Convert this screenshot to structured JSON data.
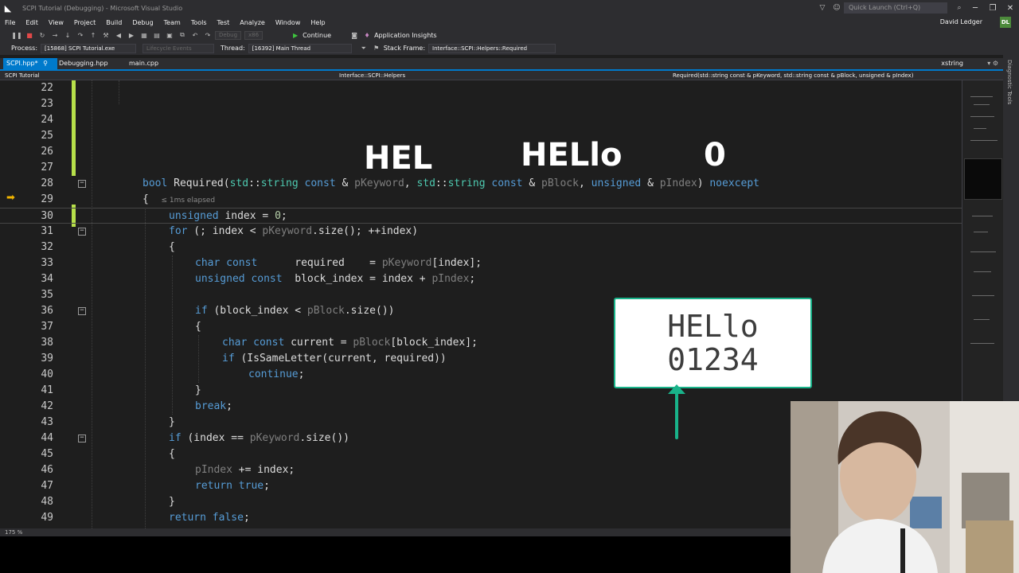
{
  "title_bar": {
    "title": "SCPI Tutorial (Debugging) - Microsoft Visual Studio",
    "quick_launch": "Quick Launch (Ctrl+Q)"
  },
  "menu": [
    "File",
    "Edit",
    "View",
    "Project",
    "Build",
    "Debug",
    "Team",
    "Tools",
    "Test",
    "Analyze",
    "Window",
    "Help"
  ],
  "user": {
    "name": "David Ledger",
    "initials": "DL"
  },
  "toolbar": {
    "config": "Debug",
    "platform": "x86",
    "continue_label": "Continue",
    "insights_label": "Application Insights"
  },
  "debug_location": {
    "process_label": "Process:",
    "process": "[15868] SCPI Tutorial.exe",
    "lifecycle": "Lifecycle Events",
    "thread_label": "Thread:",
    "thread": "[16392] Main Thread",
    "stack_label": "Stack Frame:",
    "stack": "Interface::SCPI::Helpers::Required"
  },
  "tabs": [
    {
      "label": "SCPI.hpp*",
      "active": true
    },
    {
      "label": "Debugging.hpp",
      "active": false
    },
    {
      "label": "main.cpp",
      "active": false
    }
  ],
  "tab_right": "xstring",
  "nav_bar": {
    "project": "SCPI Tutorial",
    "scope": "Interface::SCPI::Helpers",
    "member": "Required(std::string const & pKeyword, std::string const & pBlock, unsigned & pIndex)"
  },
  "side_panel_label": "Diagnostic Tools",
  "elapsed": "≤ 1ms elapsed",
  "line_numbers": [
    "22",
    "23",
    "24",
    "25",
    "26",
    "27",
    "28",
    "29",
    "30",
    "31",
    "32",
    "33",
    "34",
    "35",
    "36",
    "37",
    "38",
    "39",
    "40",
    "41",
    "42",
    "43",
    "44",
    "45",
    "46",
    "47",
    "48",
    "49"
  ],
  "overlay": {
    "text1": "HEL",
    "text2": "HELlo",
    "text3": "0",
    "card_line1": "HELlo",
    "card_line2": "01234"
  },
  "status": {
    "zoom": "175 %"
  },
  "colors": {
    "accent": "#007acc",
    "keyword": "#569cd6",
    "type": "#4ec9b0",
    "param": "#7f7f7f",
    "overlay_green": "#19b38a"
  }
}
